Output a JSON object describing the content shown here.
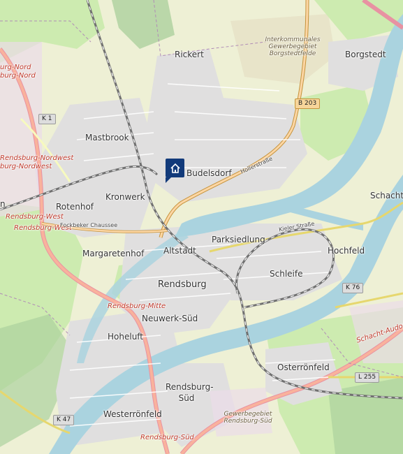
{
  "map": {
    "labels": {
      "rickert": "Rickert",
      "borgstedt": "Borgstedt",
      "gewerbe_borgstedt": "Interkommunales Gewerbegebiet Borgstedtfelde",
      "burg_nord_1": "urg-Nord",
      "burg_nord_2": "burg-Nord",
      "mastbrook": "Mastbrook",
      "budelsdorf": "Budelsdorf",
      "nordwest_1": "Rendsburg-Nordwest",
      "nordwest_2": "burg-Nordwest",
      "kronwerk": "Kronwerk",
      "rotenhof": "Rotenhof",
      "schacht_a": "Schacht-A",
      "rendsburg_west_1": "Rendsburg-West",
      "rendsburg_west_2": "Rendsburg-West",
      "fockbeker": "Fockbeker Chaussee",
      "margaretenhof": "Margaretenhof",
      "altstadt": "Altstadt",
      "parksiedlung": "Parksiedlung",
      "hochfeld": "Hochfeld",
      "kieler_strasse": "Kieler Straße",
      "schleife": "Schleife",
      "rendsburg": "Rendsburg",
      "rendsburg_mitte": "Rendsburg-Mitte",
      "neuwerk_sued": "Neuwerk-Süd",
      "hoheluft": "Hoheluft",
      "schacht_audorf": "Schacht-Audorf",
      "osterroenfeld": "Osterrönfeld",
      "rendsburg_sued": "Rendsburg-Süd",
      "westerroenfeld": "Westerrönfeld",
      "gewerbe_rendsburg_sued": "Gewerbegebiet Rendsburg-Süd",
      "station_rendsburg_sued": "Rendsburg-Süd",
      "hollerstrasse": "Hollerstraße",
      "n_left": "n"
    },
    "shields": {
      "k1": "K 1",
      "b203": "B 203",
      "k76": "K 76",
      "l255": "L 255",
      "k47": "K 47"
    },
    "marker": {
      "icon": "home-icon"
    },
    "colors": {
      "water": "#aad3df",
      "urban": "#e0dfdf",
      "green": "#cdebb0",
      "forest": "#add19e",
      "farmland": "#eef0d5",
      "trunk": "#f9b29c",
      "primary": "#fcd6a4",
      "rail": "#707070",
      "marker": "#123a7a"
    }
  }
}
